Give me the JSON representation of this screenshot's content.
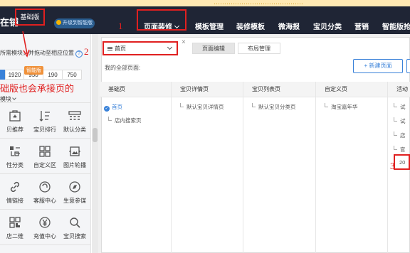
{
  "top_strip": {
    "text": "……………………………………"
  },
  "navbar": {
    "logo": "在铺",
    "edition": "基础版",
    "upgrade": "升级到智能版",
    "items": [
      "页面装修",
      "模板管理",
      "装修模板",
      "微海报",
      "宝贝分类",
      "营销",
      "智能版抢先"
    ]
  },
  "left_panel": {
    "device_hint": "所需模块，并拖动至相应位置",
    "smart_badge": "智能版",
    "widths": [
      "1920",
      "950",
      "190",
      "750"
    ],
    "red_note": "础版也会承接页的",
    "module_title": "模块",
    "modules": [
      {
        "label": "贝推荐",
        "icon": "recommend-icon"
      },
      {
        "label": "宝贝排行",
        "icon": "ranking-icon"
      },
      {
        "label": "默认分类",
        "icon": "category-icon"
      },
      {
        "label": "性分类",
        "icon": "custom-category-icon"
      },
      {
        "label": "自定义区",
        "icon": "grid-icon"
      },
      {
        "label": "图片轮播",
        "icon": "carousel-icon"
      },
      {
        "label": "情链接",
        "icon": "link-icon"
      },
      {
        "label": "客服中心",
        "icon": "service-icon"
      },
      {
        "label": "生意参谋",
        "icon": "compass-icon"
      },
      {
        "label": "店二维",
        "icon": "qrcode-icon"
      },
      {
        "label": "充值中心",
        "icon": "recharge-icon"
      },
      {
        "label": "宝贝搜索",
        "icon": "search-icon"
      }
    ]
  },
  "main": {
    "page_select": "首页",
    "tabs": [
      "页面编辑",
      "布局管理"
    ],
    "all_pages": "我的全部页面:",
    "new_page": "+ 新建页面",
    "columns": [
      {
        "header": "基础页",
        "items": [
          "首页",
          "店内搜索页"
        ]
      },
      {
        "header": "宝贝详情页",
        "items": [
          "默认宝贝详情页"
        ]
      },
      {
        "header": "宝贝列表页",
        "items": [
          "默认宝贝分类页"
        ]
      },
      {
        "header": "自定义页",
        "items": [
          "淘宝嘉年华"
        ]
      },
      {
        "header": "活动",
        "items": [
          "试",
          "试",
          "店",
          "官",
          "20"
        ]
      }
    ]
  },
  "annotations": {
    "n1": "1",
    "n2": "2",
    "n3": "3"
  },
  "colors": {
    "accent": "#3a82d9",
    "annotation": "#e02020",
    "nav_bg": "#1f2535"
  }
}
